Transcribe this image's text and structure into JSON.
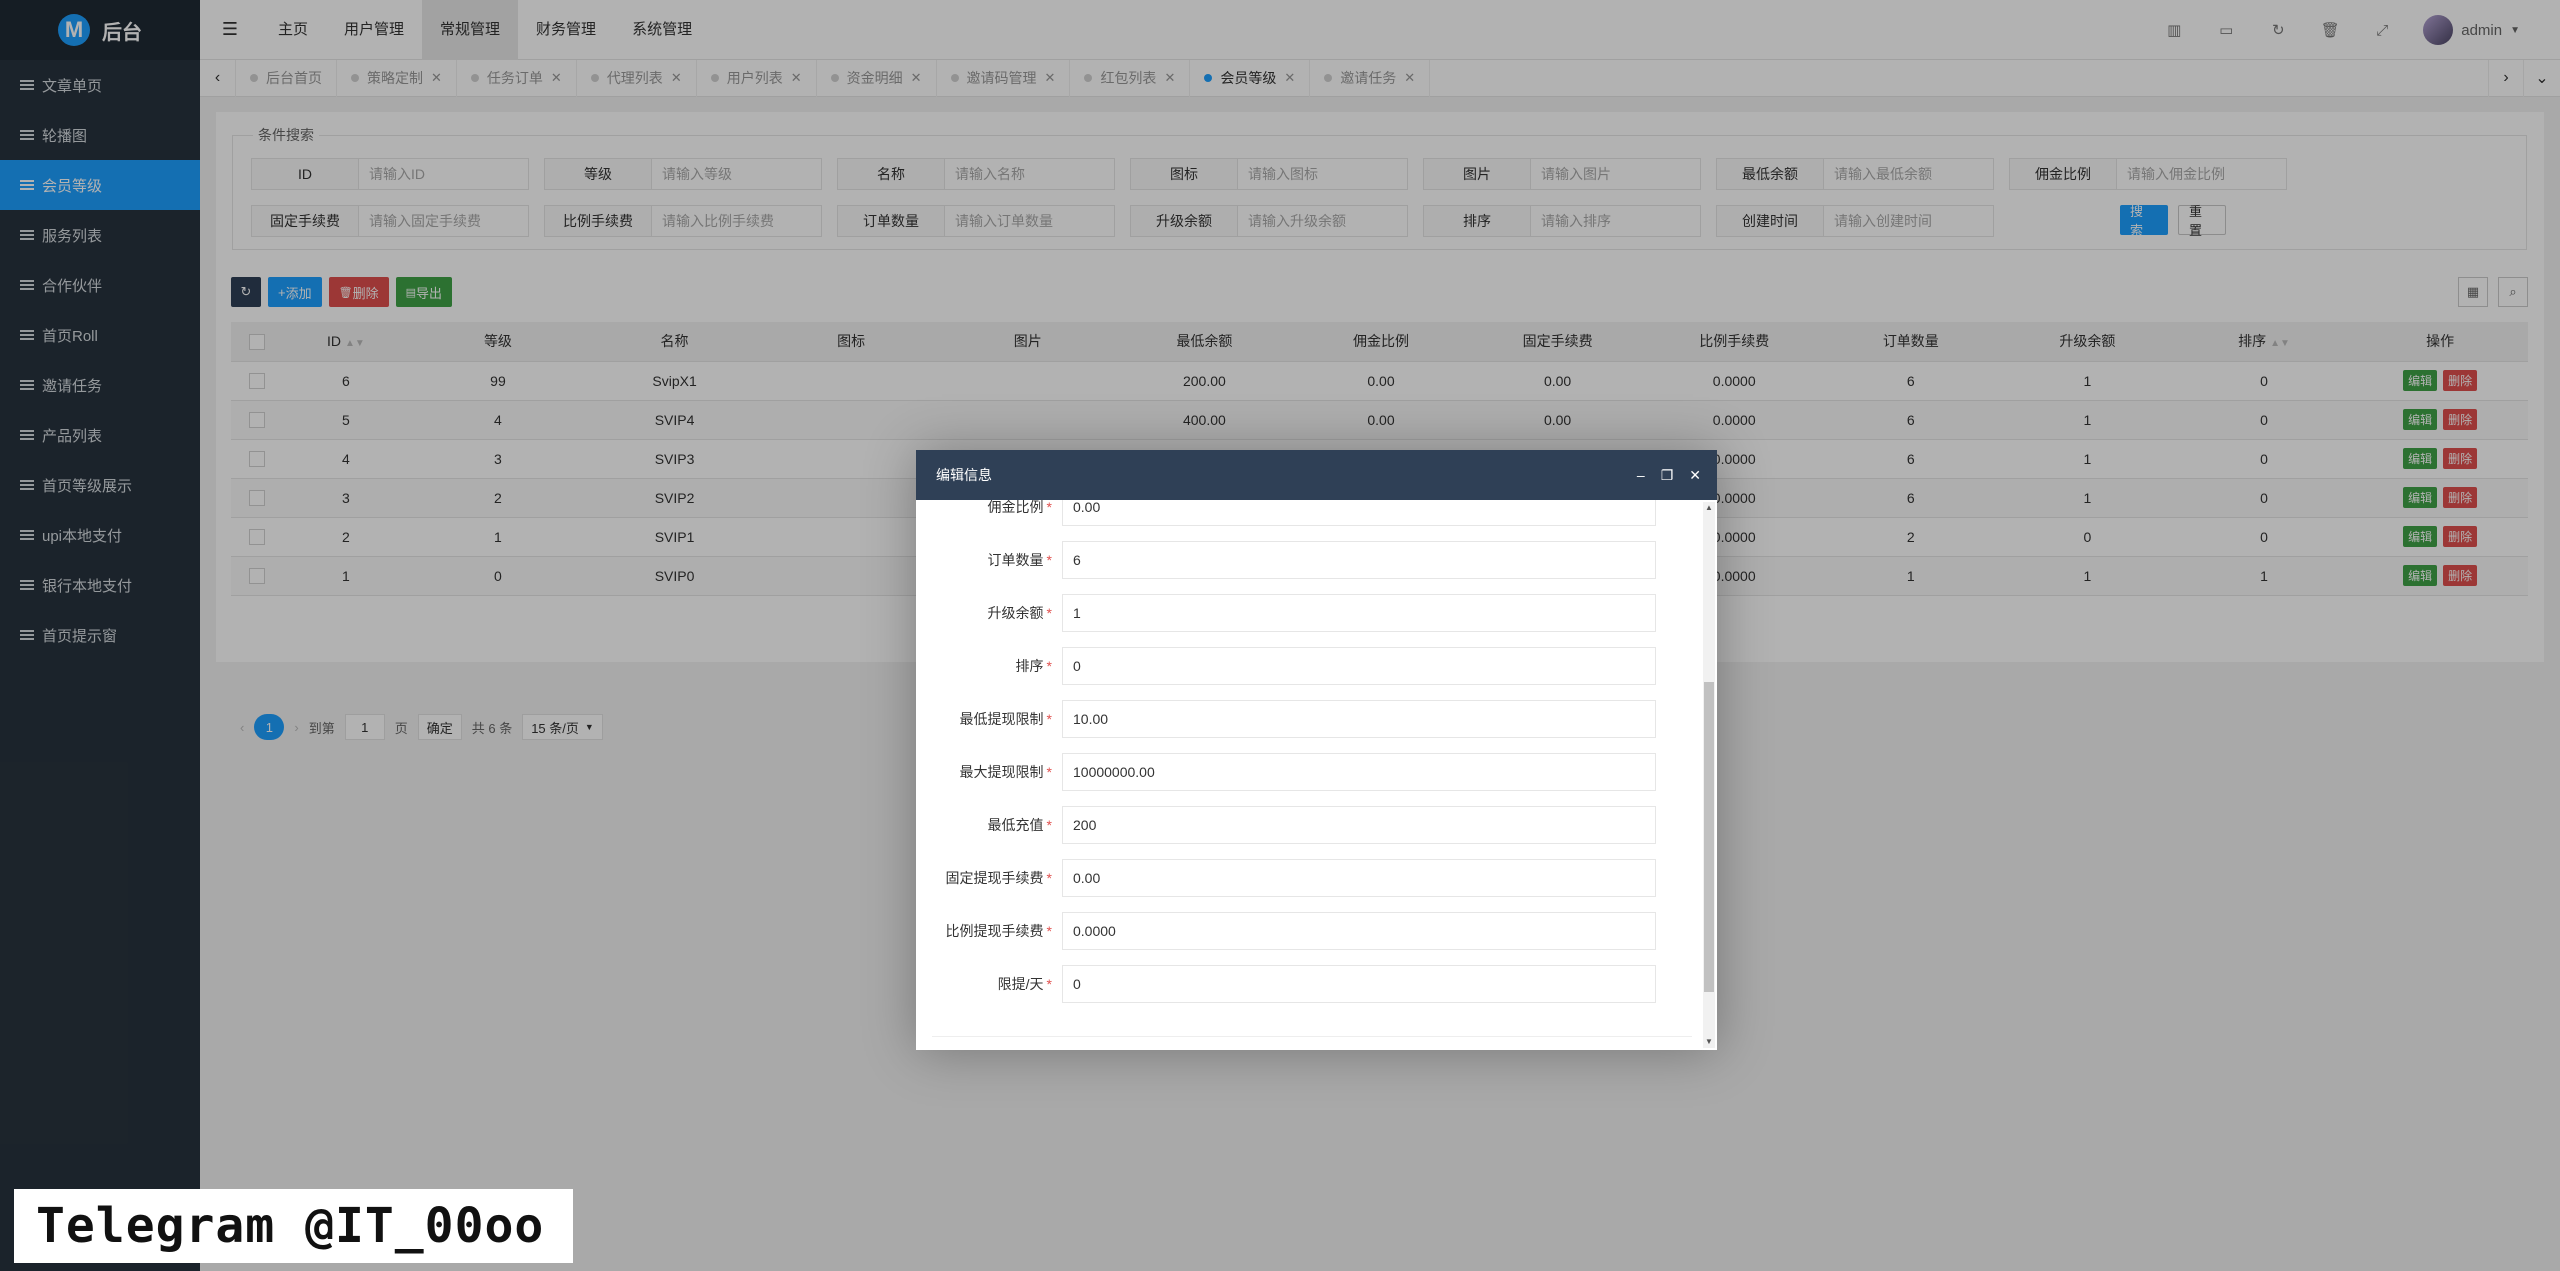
{
  "app": {
    "logo_letter": "M",
    "title": "后台"
  },
  "sidebar": {
    "items": [
      {
        "label": "文章单页",
        "active": false
      },
      {
        "label": "轮播图",
        "active": false
      },
      {
        "label": "会员等级",
        "active": true
      },
      {
        "label": "服务列表",
        "active": false
      },
      {
        "label": "合作伙伴",
        "active": false
      },
      {
        "label": "首页Roll",
        "active": false
      },
      {
        "label": "邀请任务",
        "active": false
      },
      {
        "label": "产品列表",
        "active": false
      },
      {
        "label": "首页等级展示",
        "active": false
      },
      {
        "label": "upi本地支付",
        "active": false
      },
      {
        "label": "银行本地支付",
        "active": false
      },
      {
        "label": "首页提示窗",
        "active": false
      }
    ]
  },
  "topnav": {
    "items": [
      {
        "label": "主页",
        "active": false
      },
      {
        "label": "用户管理",
        "active": false
      },
      {
        "label": "常规管理",
        "active": true
      },
      {
        "label": "财务管理",
        "active": false
      },
      {
        "label": "系统管理",
        "active": false
      }
    ],
    "user": "admin"
  },
  "tabs": [
    {
      "label": "后台首页",
      "active": false,
      "closable": false
    },
    {
      "label": "策略定制",
      "active": false,
      "closable": true
    },
    {
      "label": "任务订单",
      "active": false,
      "closable": true
    },
    {
      "label": "代理列表",
      "active": false,
      "closable": true
    },
    {
      "label": "用户列表",
      "active": false,
      "closable": true
    },
    {
      "label": "资金明细",
      "active": false,
      "closable": true
    },
    {
      "label": "邀请码管理",
      "active": false,
      "closable": true
    },
    {
      "label": "红包列表",
      "active": false,
      "closable": true
    },
    {
      "label": "会员等级",
      "active": true,
      "closable": true
    },
    {
      "label": "邀请任务",
      "active": false,
      "closable": true
    }
  ],
  "search": {
    "legend": "条件搜索",
    "fields": [
      {
        "label": "ID",
        "placeholder": "请输入ID"
      },
      {
        "label": "等级",
        "placeholder": "请输入等级"
      },
      {
        "label": "名称",
        "placeholder": "请输入名称"
      },
      {
        "label": "图标",
        "placeholder": "请输入图标"
      },
      {
        "label": "图片",
        "placeholder": "请输入图片"
      },
      {
        "label": "最低余额",
        "placeholder": "请输入最低余额"
      },
      {
        "label": "佣金比例",
        "placeholder": "请输入佣金比例"
      },
      {
        "label": "固定手续费",
        "placeholder": "请输入固定手续费"
      },
      {
        "label": "比例手续费",
        "placeholder": "请输入比例手续费"
      },
      {
        "label": "订单数量",
        "placeholder": "请输入订单数量"
      },
      {
        "label": "升级余额",
        "placeholder": "请输入升级余额"
      },
      {
        "label": "排序",
        "placeholder": "请输入排序"
      },
      {
        "label": "创建时间",
        "placeholder": "请输入创建时间"
      }
    ],
    "search_btn": "搜 索",
    "reset_btn": "重 置"
  },
  "toolbar": {
    "add": "添加",
    "delete": "删除",
    "export": "导出"
  },
  "table": {
    "columns": [
      "ID",
      "等级",
      "名称",
      "图标",
      "图片",
      "最低余额",
      "佣金比例",
      "固定手续费",
      "比例手续费",
      "订单数量",
      "升级余额",
      "排序",
      "操作"
    ],
    "rows": [
      [
        "6",
        "99",
        "SvipX1",
        "",
        "",
        "200.00",
        "0.00",
        "0.00",
        "0.0000",
        "6",
        "1",
        "0"
      ],
      [
        "5",
        "4",
        "SVIP4",
        "",
        "",
        "400.00",
        "0.00",
        "0.00",
        "0.0000",
        "6",
        "1",
        "0"
      ],
      [
        "4",
        "3",
        "SVIP3",
        "",
        "",
        "",
        "",
        "",
        "0.0000",
        "6",
        "1",
        "0"
      ],
      [
        "3",
        "2",
        "SVIP2",
        "",
        "",
        "",
        "",
        "",
        "0.0000",
        "6",
        "1",
        "0"
      ],
      [
        "2",
        "1",
        "SVIP1",
        "",
        "",
        "",
        "",
        "",
        "0.0000",
        "2",
        "0",
        "0"
      ],
      [
        "1",
        "0",
        "SVIP0",
        "",
        "",
        "",
        "",
        "",
        "0.0000",
        "1",
        "1",
        "1"
      ]
    ],
    "edit_label": "编辑",
    "delete_label": "删除"
  },
  "pager": {
    "current": "1",
    "goto_label": "到第",
    "page_input": "1",
    "page_unit": "页",
    "confirm": "确定",
    "total": "共 6 条",
    "per_page": "15 条/页"
  },
  "modal": {
    "title": "编辑信息",
    "fields": [
      {
        "label": "佣金比例",
        "value": "0.00"
      },
      {
        "label": "订单数量",
        "value": "6"
      },
      {
        "label": "升级余额",
        "value": "1"
      },
      {
        "label": "排序",
        "value": "0"
      },
      {
        "label": "最低提现限制",
        "value": "10.00"
      },
      {
        "label": "最大提现限制",
        "value": "10000000.00"
      },
      {
        "label": "最低充值",
        "value": "200"
      },
      {
        "label": "固定提现手续费",
        "value": "0.00"
      },
      {
        "label": "比例提现手续费",
        "value": "0.0000"
      },
      {
        "label": "限提/天",
        "value": "0"
      }
    ]
  },
  "watermark": "Telegram @IT_00oo",
  "colors": {
    "accent": "#1e9fff",
    "sidebar": "#28333e",
    "modal_header": "#2f4056",
    "edit": "#3fa347",
    "danger": "#e0504e"
  }
}
